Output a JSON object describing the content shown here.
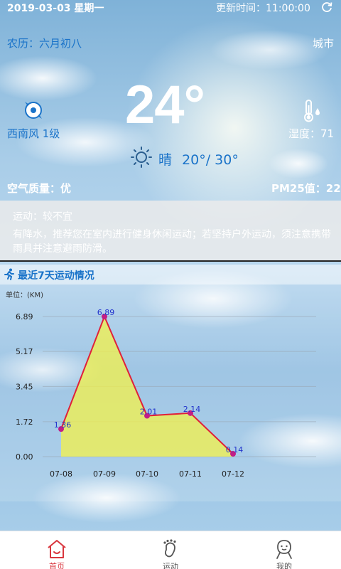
{
  "header": {
    "date": "2019-03-03 星期一",
    "updated_label": "更新时间：11:00:00",
    "lunar": "农历：六月初八",
    "city": "城市"
  },
  "weather": {
    "temperature": "24°",
    "wind": "西南风 1级",
    "humidity": "湿度：71",
    "condition": "晴",
    "range": "20°/ 30°",
    "air_quality": "空气质量：优",
    "pm25": "PM25值：22"
  },
  "advice": {
    "title": "运动：较不宜",
    "text": "有降水，推荐您在室内进行健身休闲运动；若坚持户外运动，须注意携带雨具并注意避雨防滑。"
  },
  "chart_section": {
    "title": "最近7天运动情况",
    "unit": "单位：(KM)"
  },
  "chart_data": {
    "type": "line",
    "title": "最近7天运动情况",
    "ylabel": "单位：(KM)",
    "categories": [
      "07-08",
      "07-09",
      "07-10",
      "07-11",
      "07-12"
    ],
    "values": [
      1.36,
      6.89,
      2.01,
      2.14,
      0.14
    ],
    "value_labels": [
      "1.36",
      "6.89",
      "2.01",
      "2.14",
      "0.14"
    ],
    "ytick_labels": [
      "6.89",
      "5.17",
      "3.45",
      "1.72",
      "0.00"
    ],
    "yticks": [
      6.89,
      5.17,
      3.45,
      1.72,
      0.0
    ],
    "ylim": [
      0,
      6.89
    ],
    "line_color": "#e0203a",
    "fill_color": "#f4f24a",
    "point_color": "#c21e86",
    "label_color": "#2233cc",
    "grid": true
  },
  "tabs": [
    {
      "label": "首页",
      "icon": "home-icon",
      "active": true
    },
    {
      "label": "运动",
      "icon": "footprint-icon",
      "active": false
    },
    {
      "label": "我的",
      "icon": "profile-icon",
      "active": false
    }
  ],
  "colors": {
    "accent_blue": "#1a73c9",
    "active_tab": "#d9363e"
  }
}
